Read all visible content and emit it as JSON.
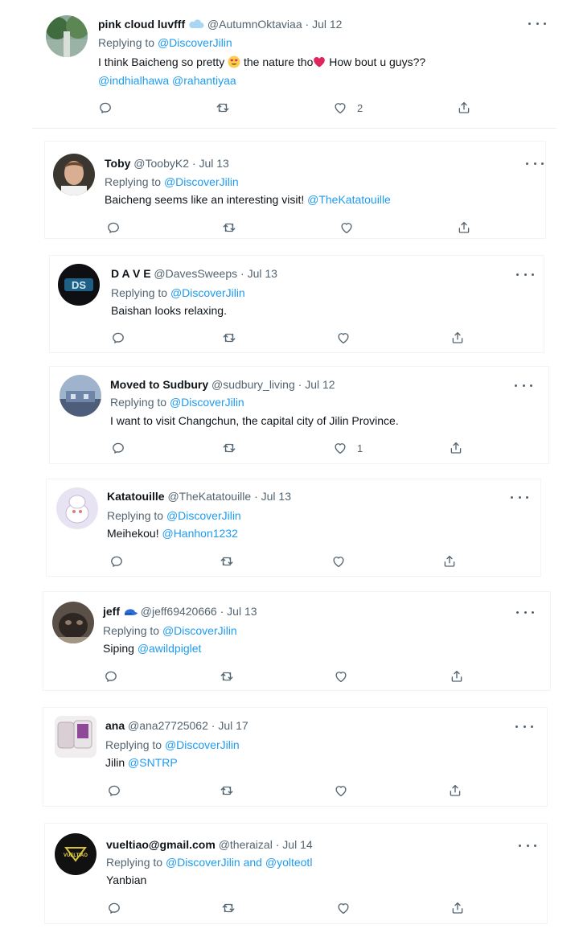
{
  "colors": {
    "text": "#0f1419",
    "muted": "#536471",
    "link": "#1d9bf0",
    "heart_emoji": "#e0245e"
  },
  "tweets": [
    {
      "name": "pink cloud luvfff",
      "name_emoji": "cloud-icon",
      "handle": "@AutumnOktaviaa",
      "sep": "·",
      "date": "Jul 12",
      "replying_prefix": "Replying to",
      "replying_to": "@DiscoverJilin",
      "text_a": "I think Baicheng so pretty",
      "text_b": "the nature tho",
      "text_c": "How bout u guys??",
      "mentions": [
        "@indhialhawa",
        "@rahantiyaa"
      ],
      "like_count": "2"
    },
    {
      "name": "Toby",
      "handle": "@ToobyK2",
      "sep": "·",
      "date": "Jul 13",
      "replying_prefix": "Replying to",
      "replying_to": "@DiscoverJilin",
      "text": "Baicheng seems like an interesting visit!",
      "mention": "@TheKatatouille"
    },
    {
      "name": "D A V E",
      "handle": "@DavesSweeps",
      "sep": "·",
      "date": "Jul 13",
      "replying_prefix": "Replying to",
      "replying_to": "@DiscoverJilin",
      "text": "Baishan looks relaxing.",
      "avatar_text": "DS"
    },
    {
      "name": "Moved to Sudbury",
      "handle": "@sudbury_living",
      "sep": "·",
      "date": "Jul 12",
      "replying_prefix": "Replying to",
      "replying_to": "@DiscoverJilin",
      "text": "I want to visit Changchun, the capital city of Jilin Province.",
      "like_count": "1"
    },
    {
      "name": "Katatouille",
      "handle": "@TheKatatouille",
      "sep": "·",
      "date": "Jul 13",
      "replying_prefix": "Replying to",
      "replying_to": "@DiscoverJilin",
      "text": "Meihekou!",
      "mention": "@Hanhon1232"
    },
    {
      "name": "jeff",
      "name_emoji": "cap-icon",
      "handle": "@jeff69420666",
      "sep": "·",
      "date": "Jul 13",
      "replying_prefix": "Replying to",
      "replying_to": "@DiscoverJilin",
      "text": "Siping",
      "mention": "@awildpiglet"
    },
    {
      "name": "ana",
      "handle": "@ana27725062",
      "sep": "·",
      "date": "Jul 17",
      "replying_prefix": "Replying to",
      "replying_to": "@DiscoverJilin",
      "text": "Jilin",
      "mention": "@SNTRP"
    },
    {
      "name": "vueltiao@gmail.com",
      "handle": "@theraizal",
      "sep": "·",
      "date": "Jul 14",
      "replying_prefix": "Replying to",
      "replying_to": "@DiscoverJilin and @yolteotl",
      "text": "Yanbian",
      "avatar_text": "VUELTIAO"
    }
  ]
}
